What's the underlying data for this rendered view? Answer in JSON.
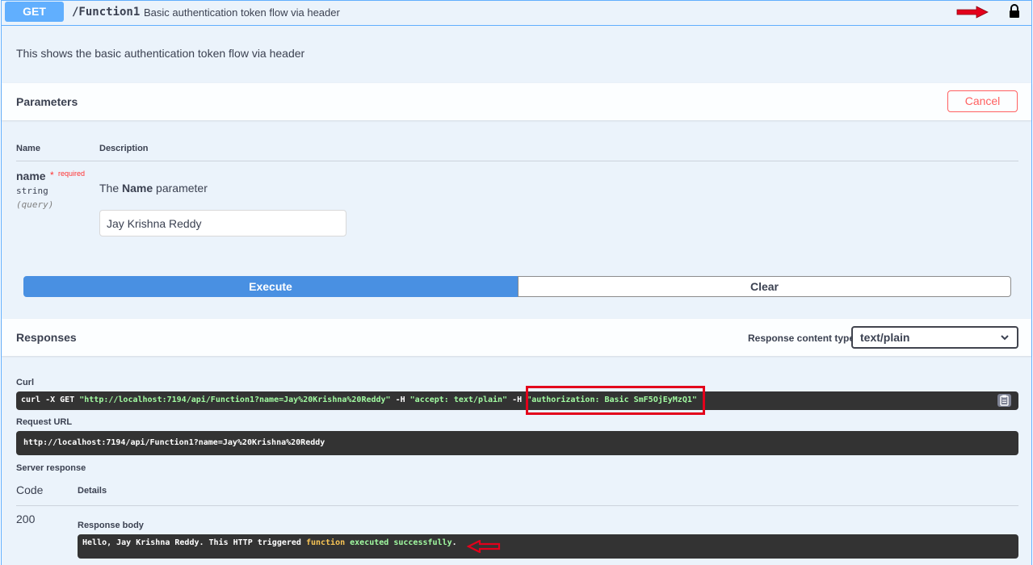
{
  "header": {
    "method": "GET",
    "path": "/Function1",
    "summary": "Basic authentication token flow via header"
  },
  "description": "This shows the basic authentication token flow via header",
  "parameters": {
    "title": "Parameters",
    "cancel_label": "Cancel",
    "col_name": "Name",
    "col_description": "Description",
    "items": [
      {
        "name": "name",
        "required_star": "*",
        "required_label": "required",
        "type": "string",
        "in": "(query)",
        "desc_prefix": "The ",
        "desc_bold": "Name",
        "desc_suffix": " parameter",
        "value": "Jay Krishna Reddy"
      }
    ]
  },
  "actions": {
    "execute_label": "Execute",
    "clear_label": "Clear"
  },
  "responses": {
    "title": "Responses",
    "content_type_label": "Response content type",
    "content_type_value": "text/plain",
    "curl_label": "Curl",
    "curl": {
      "cmd1": "curl -X GET ",
      "url": "\"http://localhost:7194/api/Function1?name=Jay%20Krishna%20Reddy\"",
      "h1": " -H  ",
      "accept": "\"accept: text/plain\"",
      "h2": " -H  ",
      "auth": "\"authorization: Basic SmF5OjEyMzQ1\""
    },
    "request_url_label": "Request URL",
    "request_url": "http://localhost:7194/api/Function1?name=Jay%20Krishna%20Reddy",
    "server_response_label": "Server response",
    "code_col": "Code",
    "details_col": "Details",
    "code": "200",
    "response_body_label": "Response body",
    "body": {
      "p1": "Hello, Jay Krishna Reddy. This HTTP triggered ",
      "kw_function": "function",
      "p2": " executed ",
      "kw_success": "successfully",
      "p3": "."
    }
  },
  "colors": {
    "get_blue": "#61affe",
    "execute_blue": "#4990e2",
    "cancel_red": "#ff6060",
    "annotation_red": "#e3001b",
    "code_bg": "#333333"
  }
}
